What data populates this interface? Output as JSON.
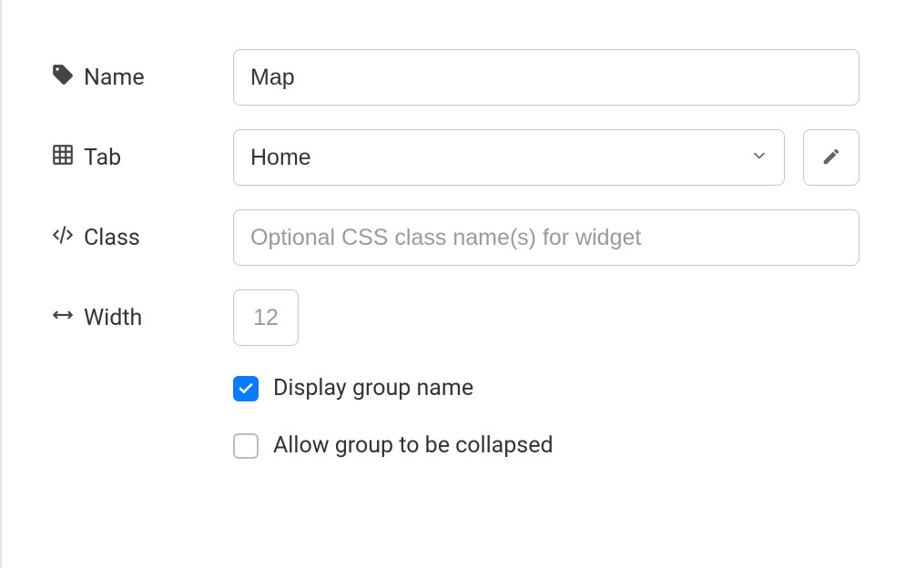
{
  "labels": {
    "name": "Name",
    "tab": "Tab",
    "class": "Class",
    "width": "Width"
  },
  "fields": {
    "name_value": "Map",
    "tab_value": "Home",
    "class_value": "",
    "class_placeholder": "Optional CSS class name(s) for widget",
    "width_value": "12"
  },
  "checkboxes": {
    "display_group": {
      "label": "Display group name",
      "checked": true
    },
    "allow_collapse": {
      "label": "Allow group to be collapsed",
      "checked": false
    }
  }
}
